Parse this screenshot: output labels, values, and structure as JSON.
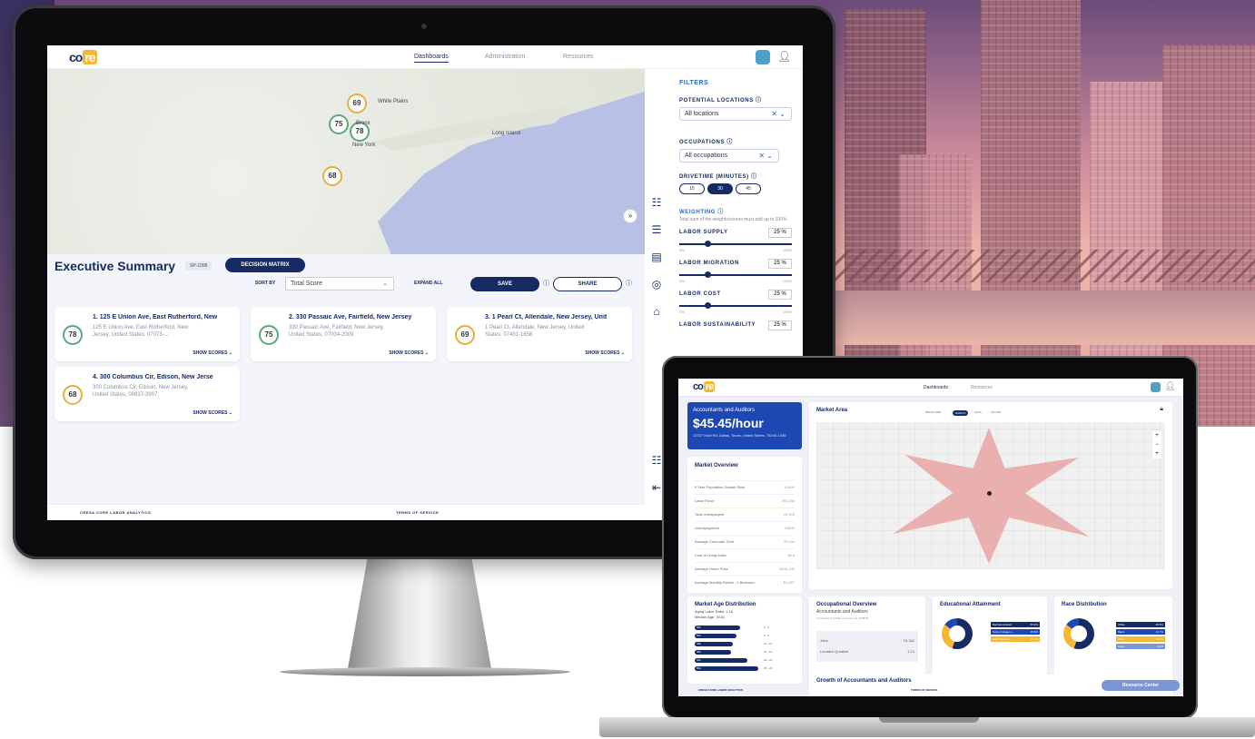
{
  "monitor": {
    "logo": {
      "left": "co",
      "right": "re"
    },
    "nav": {
      "tabs": [
        "Dashboards",
        "Administration",
        "Resources"
      ],
      "active": "Dashboards"
    },
    "map": {
      "pins": [
        "69",
        "75",
        "78",
        "68"
      ],
      "labels": [
        "White Plains",
        "Bronx",
        "New York",
        "Long Island"
      ]
    },
    "summary": {
      "title": "Executive Summary",
      "code": "SP-1095",
      "decision_matrix": "DECISION MATRIX",
      "sort_by_label": "SORT BY",
      "sort_by_value": "Total Score",
      "expand_all": "EXPAND ALL",
      "save": "SAVE",
      "share": "SHARE"
    },
    "cards": [
      {
        "score": "78",
        "title": "1. 125 E Union Ave, East Rutherford, New",
        "addr": "125 E Union Ave, East Rutherford, New Jersey, United States, 07073-...",
        "action": "SHOW SCORES"
      },
      {
        "score": "75",
        "title": "2. 330 Passaic Ave, Fairfield, New Jersey",
        "addr": "330 Passaic Ave, Fairfield, New Jersey, United States, 07004-2009",
        "action": "SHOW SCORES"
      },
      {
        "score": "69",
        "title": "3. 1 Pearl Ct, Allendale, New Jersey, Unit",
        "addr": "1 Pearl Ct, Allendale, New Jersey, United States, 07401-1658",
        "action": "SHOW SCORES"
      },
      {
        "score": "68",
        "title": "4. 300 Columbus Cir, Edison, New Jerse",
        "addr": "300 Columbus Cir, Edison, New Jersey, United States, 08837-3907",
        "action": "SHOW SCORES"
      }
    ],
    "filters": {
      "title": "FILTERS",
      "potential_locations_label": "POTENTIAL LOCATIONS",
      "potential_locations_value": "All locations",
      "occupations_label": "OCCUPATIONS",
      "occupations_value": "All occupations",
      "drivetime_label": "DRIVETIME (MINUTES)",
      "drivetime_options": [
        "15",
        "30",
        "45"
      ],
      "drivetime_selected": "30",
      "weighting_label": "WEIGHTING",
      "weighting_note": "Total sum of the weights/scores must add up to 100%",
      "weights": [
        {
          "name": "LABOR SUPPLY",
          "value": "25",
          "unit": "%",
          "level": 0.25,
          "min": "0%",
          "max": "100%"
        },
        {
          "name": "LABOR MIGRATION",
          "value": "25",
          "unit": "%",
          "level": 0.25,
          "min": "0%",
          "max": "100%"
        },
        {
          "name": "LABOR COST",
          "value": "25",
          "unit": "%",
          "level": 0.25,
          "min": "0%",
          "max": "100%"
        },
        {
          "name": "LABOR SUSTAINABILITY",
          "value": "25",
          "unit": "%",
          "level": 0.25,
          "min": "",
          "max": ""
        }
      ]
    },
    "footer": {
      "left": "CRESA CORE LABOR ANALYTICS",
      "right": "TERMS OF SERVICE"
    }
  },
  "laptop": {
    "nav": {
      "tabs": [
        "Dashboards",
        "Resources"
      ],
      "active": "Dashboards"
    },
    "job": {
      "title": "Accountants and Auditors",
      "wage": "$45.45/hour",
      "address": "13727 Noel Rd, Dallas, Texas, United States, 75240-1336"
    },
    "market_overview": {
      "title": "Market Overview",
      "rows": [
        {
          "label": "5 Year Population Growth Rate",
          "value": "4.28%"
        },
        {
          "label": "Labor Force",
          "value": "393,248"
        },
        {
          "label": "Total Unemployed",
          "value": "23,925"
        },
        {
          "label": "Unemployment",
          "value": "3.82%"
        },
        {
          "label": "Average Commute Time",
          "value": "25 min"
        },
        {
          "label": "Cost of Living Index",
          "value": "98.8"
        },
        {
          "label": "Average Home Price",
          "value": "$349,100"
        },
        {
          "label": "Average Monthly Rental - 1 Bedroom",
          "value": "$1,267"
        }
      ]
    },
    "market_area": {
      "title": "Market Area",
      "modes": [
        "DRIVE TIME",
        "RADIUS",
        "ZCTA",
        "ACTIVE"
      ],
      "active_mode": "RADIUS"
    },
    "age": {
      "title": "Market Age Distribution",
      "sub1": "Aging Labor Ratio: 1.16",
      "sub2": "Median Age: 30.81",
      "ranges": [
        "0 - 4",
        "5 - 9",
        "10 - 14",
        "15 - 19",
        "20 - 24",
        "25 - 29"
      ],
      "bars": [
        "58k",
        "54k",
        "49k",
        "45k",
        "63k",
        "83k"
      ]
    },
    "occupational": {
      "title": "Occupational Overview",
      "sub": "Accountants and Auditors",
      "note": "Compared to NAME previous year",
      "change": "-4.35 %",
      "jobs_label": "Jobs",
      "jobs_value": "15,342",
      "lq_label": "Location Quotient",
      "lq_value": "1.12"
    },
    "education": {
      "title": "Educational Attainment",
      "legend": [
        {
          "label": "Bachelors/Grad",
          "value": "55.9%"
        },
        {
          "label": "Some College o...",
          "value": "15.9%"
        },
        {
          "label": "High School or...",
          "value": "28.2%"
        }
      ]
    },
    "race": {
      "title": "Race Distribution",
      "legend": [
        {
          "label": "White",
          "value": "48.5%"
        },
        {
          "label": "Black",
          "value": "14.7%"
        },
        {
          "label": "Other",
          "value": "28.5%"
        },
        {
          "label": "Asian",
          "value": "8.3%"
        }
      ]
    },
    "growth": {
      "title": "Growth of Accountants and Auditors"
    },
    "resource_center": "Resource Center",
    "footer": {
      "left": "CRESA CORE LABOR ANALYTICS",
      "right": "TERMS OF SERVICE"
    }
  },
  "colors": {
    "navy": "#162a63",
    "blue": "#1d47b3",
    "gold": "#f5b731",
    "green": "#5ca77b"
  }
}
